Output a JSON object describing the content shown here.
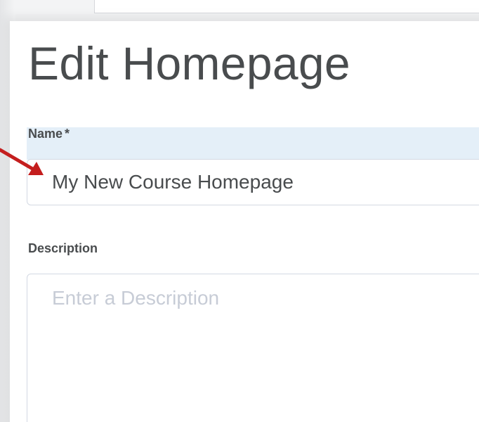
{
  "page": {
    "title": "Edit Homepage"
  },
  "form": {
    "name_label": "Name",
    "name_required_marker": "*",
    "name_value": "My New Course Homepage",
    "description_label": "Description",
    "description_placeholder": "Enter a Description"
  },
  "annotation": {
    "arrow_color": "#c41e1e",
    "arrow_target": "name-input"
  },
  "colors": {
    "text": "#494c4e",
    "focus_highlight": "#e4eff8",
    "input_border": "#d3d9e3",
    "placeholder": "#c7ccd6"
  }
}
